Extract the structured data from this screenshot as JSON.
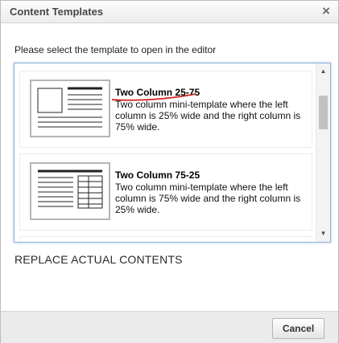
{
  "dialog": {
    "title": "Content Templates",
    "close_symbol": "×",
    "instruction": "Please select the template to open in the editor"
  },
  "templates": [
    {
      "title": "Two Column 25-75",
      "description": "Two column mini-template where the left column is 25% wide and the right column is 75% wide.",
      "thumbnail_icon": "two-column-25-75-layout-icon"
    },
    {
      "title": "Two Column 75-25",
      "description": "Two column mini-template where the left column is 75% wide and the right column is 25% wide.",
      "thumbnail_icon": "two-column-75-25-layout-icon"
    }
  ],
  "scrollbar": {
    "up_symbol": "▲",
    "down_symbol": "▼"
  },
  "replace_label": "REPLACE ACTUAL CONTENTS",
  "footer": {
    "cancel_label": "Cancel"
  },
  "colors": {
    "annotation_underline": "#d21f1f",
    "listbox_focus_border": "#8fb2d9"
  }
}
